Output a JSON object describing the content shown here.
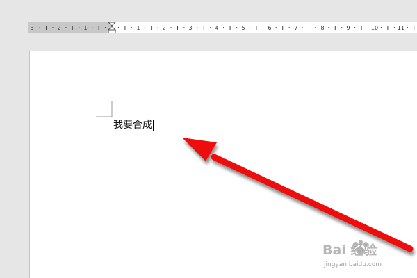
{
  "ruler": {
    "labels": [
      "3",
      "2",
      "1",
      "1",
      "2",
      "3",
      "4",
      "5",
      "6",
      "7",
      "8",
      "9",
      "10",
      "11"
    ]
  },
  "document": {
    "text": "我要合成"
  },
  "annotation": {
    "arrow_color": "#ee1111"
  },
  "watermark": {
    "logo": "Bai 经验",
    "url": "jingyan.baidu.com"
  },
  "colors": {
    "background": "#e6e6e6",
    "page": "#ffffff",
    "ruler_margin": "#c8c8c8"
  }
}
